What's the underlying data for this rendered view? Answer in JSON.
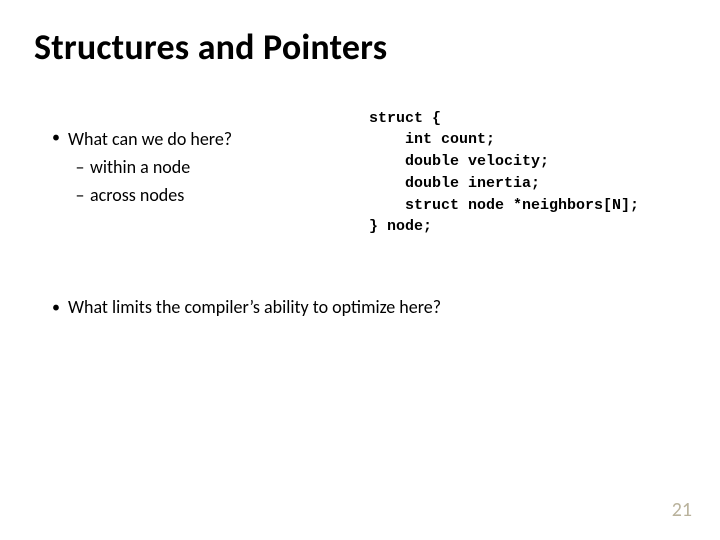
{
  "title": "Structures and Pointers",
  "left": {
    "q1": "What can we do here?",
    "q1a": "within a node",
    "q1b": "across nodes"
  },
  "code": {
    "l1": "struct {",
    "l2": "    int count;",
    "l3": "    double velocity;",
    "l4": "    double inertia;",
    "l5": "    struct node *neighbors[N];",
    "l6": "} node;"
  },
  "lower": {
    "q2": "What limits the compiler’s ability to optimize here?"
  },
  "glyphs": {
    "bullet": "•",
    "dash": "–"
  },
  "page": "21"
}
